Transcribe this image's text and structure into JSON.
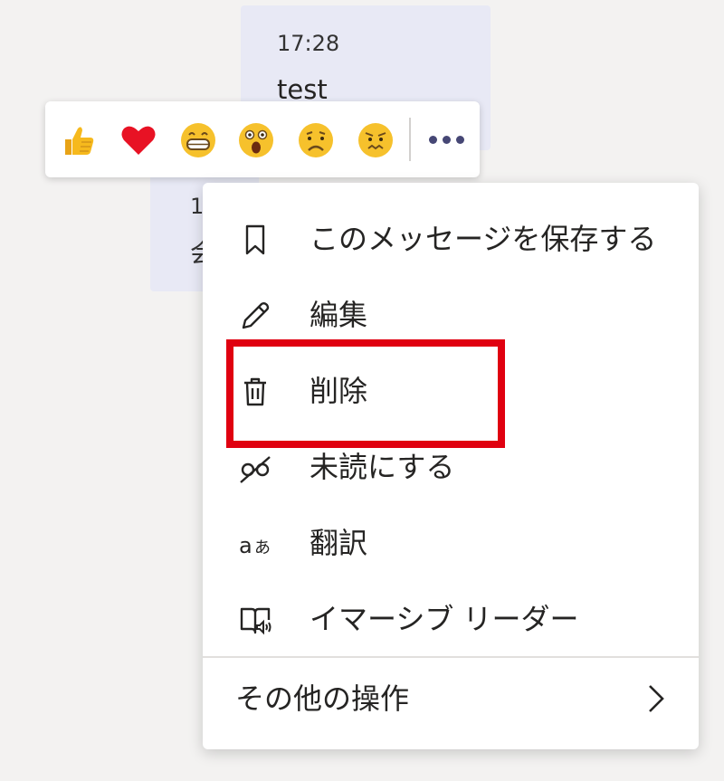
{
  "messages": [
    {
      "time": "17:28",
      "text": "test"
    },
    {
      "time_partial": "1",
      "text_partial": "会"
    }
  ],
  "reactions": [
    {
      "name": "like",
      "icon": "thumbs-up-icon"
    },
    {
      "name": "heart",
      "icon": "heart-icon"
    },
    {
      "name": "laugh",
      "icon": "laugh-icon"
    },
    {
      "name": "surprised",
      "icon": "surprised-icon"
    },
    {
      "name": "sad",
      "icon": "sad-icon"
    },
    {
      "name": "angry",
      "icon": "angry-icon"
    }
  ],
  "more_options_icon": "more-options-icon",
  "menu": {
    "items": [
      {
        "label": "このメッセージを保存する",
        "icon": "bookmark-icon"
      },
      {
        "label": "編集",
        "icon": "pencil-icon"
      },
      {
        "label": "削除",
        "icon": "trash-icon"
      },
      {
        "label": "未読にする",
        "icon": "mark-unread-icon"
      },
      {
        "label": "翻訳",
        "icon": "translate-icon"
      },
      {
        "label": "イマーシブ リーダー",
        "icon": "immersive-reader-icon"
      }
    ],
    "more_actions": {
      "label": "その他の操作",
      "icon": "chevron-right-icon"
    }
  },
  "colors": {
    "accent": "#464775",
    "highlight": "#e00010",
    "bubble": "#e8e9f5"
  }
}
